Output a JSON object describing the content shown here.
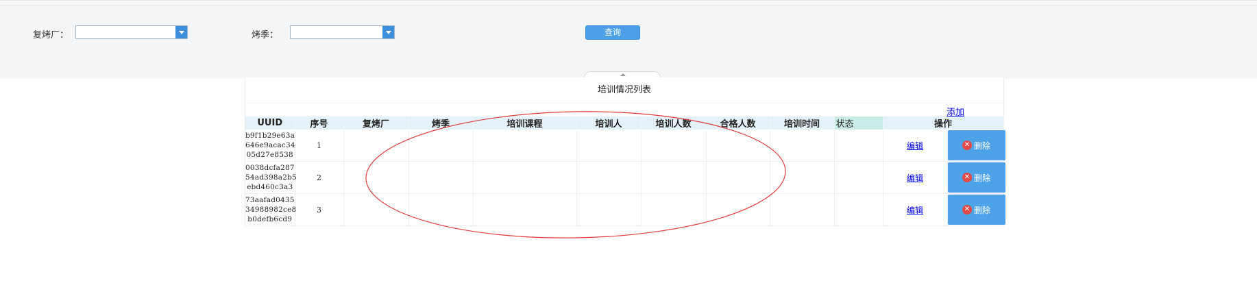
{
  "filters": {
    "factory_label": "复烤厂：",
    "season_label": "烤季：",
    "factory_value": "",
    "season_value": "",
    "query_label": "查询"
  },
  "grid": {
    "title": "培训情况列表",
    "add_label": "添加",
    "columns": [
      "UUID",
      "序号",
      "复烤厂",
      "烤季",
      "培训课程",
      "培训人",
      "培训人数",
      "合格人数",
      "培训时间",
      "状态",
      "操作"
    ],
    "rows": [
      {
        "uuid": [
          "b9f1b29e63a",
          "646e9acac34",
          "05d27e8538"
        ],
        "index": "1",
        "factory": "",
        "season": "",
        "course": "",
        "trainer": "",
        "trainee_count": "",
        "qualified_count": "",
        "time": "",
        "status": ""
      },
      {
        "uuid": [
          "0038dcfa287",
          "54ad398a2b5",
          "ebd460c3a3"
        ],
        "index": "2",
        "factory": "",
        "season": "",
        "course": "",
        "trainer": "",
        "trainee_count": "",
        "qualified_count": "",
        "time": "",
        "status": ""
      },
      {
        "uuid": [
          "73aafad0435",
          "34988982ce8",
          "b0defb6cd9"
        ],
        "index": "3",
        "factory": "",
        "season": "",
        "course": "",
        "trainer": "",
        "trainee_count": "",
        "qualified_count": "",
        "time": "",
        "status": ""
      }
    ],
    "edit_label": "编辑",
    "delete_label": "删除",
    "delete_icon_glyph": "✕"
  },
  "colors": {
    "header_bg": "#e4f1f8",
    "status_header_bg": "#c9ece8",
    "button_blue": "#4ea3e8",
    "annotation_red": "#e03a3a"
  }
}
